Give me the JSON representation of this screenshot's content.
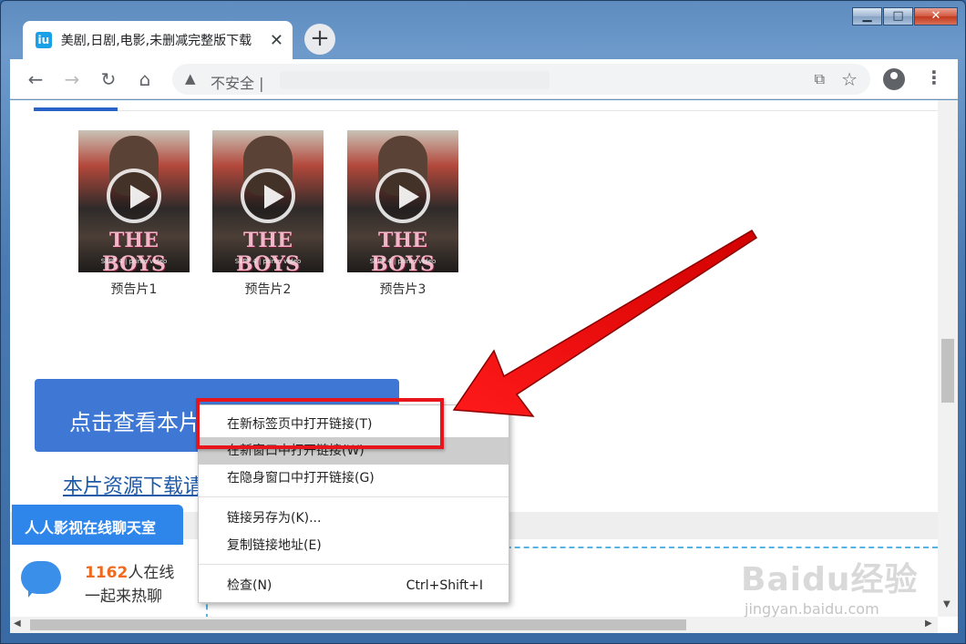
{
  "browser": {
    "tab": {
      "favicon": "iu",
      "title": "美剧,日剧,电影,未删减完整版下载",
      "close_icon": "close-icon"
    },
    "new_tab_label": "+",
    "window_controls": {
      "minimize": "▁",
      "maximize": "□",
      "close": "✕"
    },
    "toolbar": {
      "back_icon": "arrow-left-icon",
      "forward_icon": "arrow-right-icon",
      "reload_icon": "reload-icon",
      "home_icon": "home-icon",
      "security_label": "不安全",
      "security_separator": "|",
      "bookmark_icon": "star-icon",
      "account_icon": "account-icon",
      "menu_icon": "more-vert-icon"
    }
  },
  "page": {
    "trailers": [
      {
        "caption": "预告片1",
        "logo": "THE BOYS",
        "sub": "SEPT 4 | prime video"
      },
      {
        "caption": "预告片2",
        "logo": "THE BOYS",
        "sub": "SEPT 4 | prime video"
      },
      {
        "caption": "预告片3",
        "logo": "THE BOYS",
        "sub": "SEPT 4 | prime video"
      }
    ],
    "watch_button": "点击查看本片",
    "download_link": "本片资源下载请",
    "chat": {
      "header": "人人影视在线聊天室",
      "online_count": "1162",
      "online_suffix": "人在线",
      "invite": "一起来热聊"
    }
  },
  "context_menu": {
    "items": [
      {
        "label": "在新标签页中打开链接(T)"
      },
      {
        "label": "在新窗口中打开链接(W)"
      },
      {
        "label": "在隐身窗口中打开链接(G)"
      },
      {
        "label": "链接另存为(K)..."
      },
      {
        "label": "复制链接地址(E)"
      },
      {
        "label": "检查(N)",
        "shortcut": "Ctrl+Shift+I"
      }
    ]
  },
  "watermark": {
    "logo": "Baidu经验",
    "url": "jingyan.baidu.com"
  },
  "colors": {
    "accent_blue": "#3f77d4",
    "chat_blue": "#2f86ea",
    "highlight_red": "#e8141b",
    "online_orange": "#ef6a1e"
  }
}
